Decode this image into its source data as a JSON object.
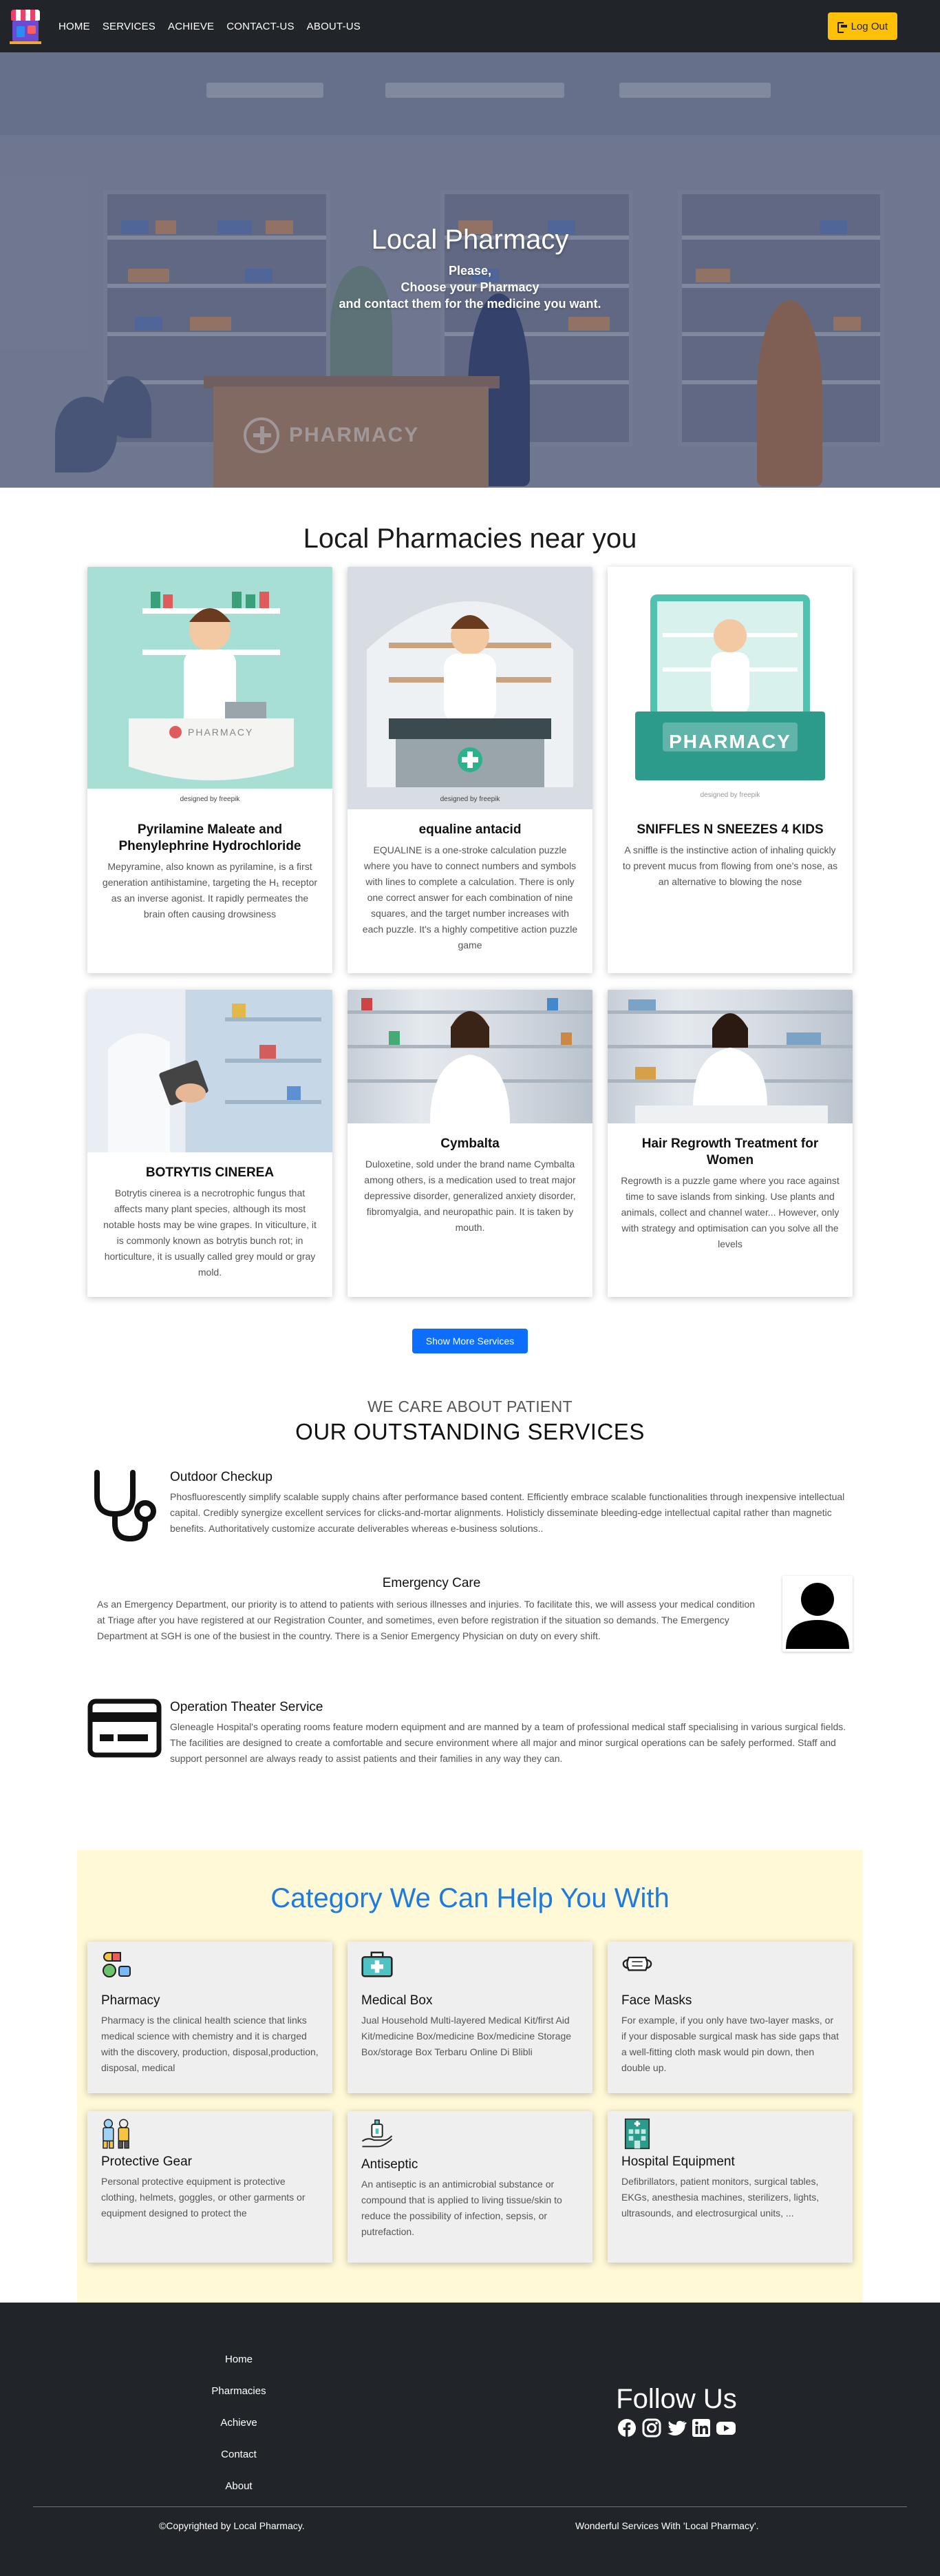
{
  "nav": {
    "links": [
      "HOME",
      "SERVICES",
      "ACHIEVE",
      "CONTACT-US",
      "ABOUT-US"
    ],
    "logout_label": "Log Out"
  },
  "hero": {
    "title": "Local Pharmacy",
    "line1": "Please,",
    "line2": "Choose your Pharmacy",
    "line3": "and contact them for the medicine you want.",
    "counter_sign": "PHARMACY"
  },
  "pharmacies": {
    "title": "Local Pharmacies near you",
    "cards": [
      {
        "title": "Pyrilamine Maleate and Phenylephrine Hydrochloride",
        "text": "Mepyramine, also known as pyrilamine, is a first generation antihistamine, targeting the H₁ receptor as an inverse agonist. It rapidly permeates the brain often causing drowsiness",
        "image_sign": "PHARMACY",
        "image_credit": "designed by freepik"
      },
      {
        "title": "equaline antacid",
        "text": "EQUALINE is a one-stroke calculation puzzle where you have to connect numbers and symbols with lines to complete a calculation. There is only one correct answer for each combination of nine squares, and the target number increases with each puzzle. It's a highly competitive action puzzle game",
        "image_credit": "designed by freepik"
      },
      {
        "title": "SNIFFLES N SNEEZES 4 KIDS",
        "text": "A sniffle is the instinctive action of inhaling quickly to prevent mucus from flowing from one's nose, as an alternative to blowing the nose",
        "image_sign": "PHARMACY",
        "image_credit": "designed by freepik"
      },
      {
        "title": "BOTRYTIS CINEREA",
        "text": "Botrytis cinerea is a necrotrophic fungus that affects many plant species, although its most notable hosts may be wine grapes. In viticulture, it is commonly known as botrytis bunch rot; in horticulture, it is usually called grey mould or gray mold."
      },
      {
        "title": "Cymbalta",
        "text": "Duloxetine, sold under the brand name Cymbalta among others, is a medication used to treat major depressive disorder, generalized anxiety disorder, fibromyalgia, and neuropathic pain. It is taken by mouth."
      },
      {
        "title": "Hair Regrowth Treatment for Women",
        "text": "Regrowth is a puzzle game where you race against time to save islands from sinking. Use plants and animals, collect and channel water... However, only with strategy and optimisation can you solve all the levels"
      }
    ],
    "more_button": "Show More Services"
  },
  "services": {
    "eyebrow": "WE CARE ABOUT PATIENT",
    "title": "OUR OUTSTANDING SERVICES",
    "items": [
      {
        "title": "Outdoor Checkup",
        "text": "Phosfluorescently simplify scalable supply chains after performance based content. Efficiently embrace scalable functionalities through inexpensive intellectual capital. Credibly synergize excellent services for clicks-and-mortar alignments. Holisticly disseminate bleeding-edge intellectual capital rather than magnetic benefits. Authoritatively customize accurate deliverables whereas e-business solutions..",
        "icon": "stethoscope-icon"
      },
      {
        "title": "Emergency Care",
        "text": "As an Emergency Department, our priority is to attend to patients with serious illnesses and injuries. To facilitate this, we will assess your medical condition at Triage after you have registered at our Registration Counter, and sometimes, even before registration if the situation so demands. The Emergency Department at SGH is one of the busiest in the country. There is a Senior Emergency Physician on duty on every shift.",
        "icon": "user-icon"
      },
      {
        "title": "Operation Theater Service",
        "text": "Gleneagle Hospital's operating rooms feature modern equipment and are manned by a team of professional medical staff specialising in various surgical fields. The facilities are designed to create a comfortable and secure environment where all major and minor surgical operations can be safely performed. Staff and support personnel are always ready to assist patients and their families in any way they can.",
        "icon": "credit-card-icon"
      }
    ]
  },
  "category": {
    "title": "Category We Can Help You With",
    "cards": [
      {
        "title": "Pharmacy",
        "text": "Pharmacy is the clinical health science that links medical science with chemistry and it is charged with the discovery, production, disposal,production, disposal, medical",
        "icon": "pills-icon"
      },
      {
        "title": "Medical Box",
        "text": "Jual Household Multi-layered Medical Kit/first Aid Kit/medicine Box/medicine Box/medicine Storage Box/storage Box Terbaru Online Di Blibli",
        "icon": "first-aid-kit-icon"
      },
      {
        "title": "Face Masks",
        "text": "For example, if you only have two-layer masks, or if your disposable surgical mask has side gaps that a well-fitting cloth mask would pin down, then double up.",
        "icon": "face-mask-icon"
      },
      {
        "title": "Protective Gear",
        "text": "Personal protective equipment is protective clothing, helmets, goggles, or other garments or equipment designed to protect the",
        "icon": "protective-suit-icon"
      },
      {
        "title": "Antiseptic",
        "text": "An antiseptic is an antimicrobial substance or compound that is applied to living tissue/skin to reduce the possibility of infection, sepsis, or putrefaction.",
        "icon": "hand-sanitizer-icon"
      },
      {
        "title": "Hospital Equipment",
        "text": "Defibrillators, patient monitors, surgical tables, EKGs, anesthesia machines, sterilizers, lights, ultrasounds, and electrosurgical units, ...",
        "icon": "hospital-building-icon"
      }
    ]
  },
  "footer": {
    "links": [
      "Home",
      "Pharmacies",
      "Achieve",
      "Contact",
      "About"
    ],
    "follow_title": "Follow Us",
    "socials": [
      "facebook-icon",
      "instagram-icon",
      "twitter-icon",
      "linkedin-icon",
      "youtube-icon"
    ],
    "copyright": "©Copyrighted by Local Pharmacy.",
    "tagline": "Wonderful Services With 'Local Pharmacy'."
  },
  "colors": {
    "navbar": "#212529",
    "logout": "#ffc107",
    "primary_button": "#0d6efd",
    "category_bg": "#fff9d8",
    "category_title": "#1f7ae0"
  }
}
